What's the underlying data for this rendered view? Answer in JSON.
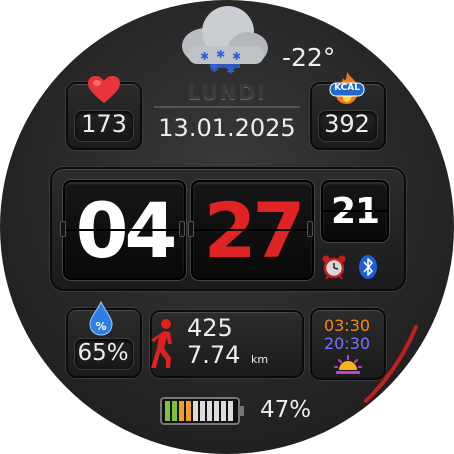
{
  "weather": {
    "temperature": "-22°",
    "condition": "snow-cloud-icon"
  },
  "date": {
    "day_name": "LUNDI",
    "date": "13.01.2025"
  },
  "heart_rate": {
    "value": "173",
    "icon": "heart-icon"
  },
  "calories": {
    "value": "392",
    "badge": "KCAL",
    "icon": "flame-icon"
  },
  "time": {
    "hours": "04",
    "minutes": "27",
    "seconds": "21"
  },
  "status_icons": {
    "alarm": "alarm-clock-icon",
    "bluetooth": "bluetooth-icon"
  },
  "humidity": {
    "value": "65%",
    "badge": "%",
    "icon": "water-drop-icon"
  },
  "steps": {
    "count": "425",
    "distance": "7.74",
    "unit": "km",
    "icon": "walking-person-icon"
  },
  "sun": {
    "sunrise": "03:30",
    "sunset": "20:30",
    "icon": "sunrise-icon"
  },
  "battery": {
    "percent_label": "47%",
    "level": 0.47,
    "icon": "battery-icon"
  },
  "colors": {
    "accent_red": "#e02424",
    "sunrise_orange": "#f08a1c",
    "sunset_purple": "#7a73ff",
    "battery_green": "#7ec23a",
    "battery_orange": "#f0a020"
  }
}
